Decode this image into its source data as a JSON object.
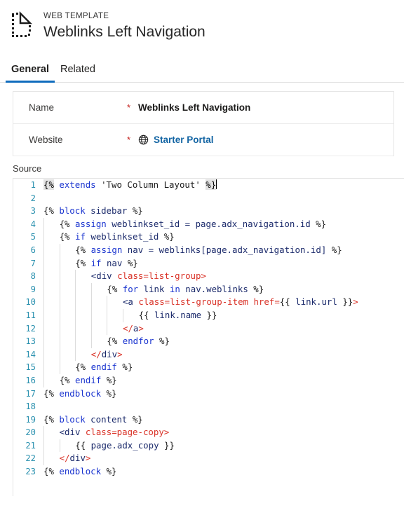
{
  "header": {
    "entity_type": "WEB TEMPLATE",
    "title": "Weblinks Left Navigation",
    "icon": "web-template-document-icon"
  },
  "tabs": [
    {
      "label": "General",
      "selected": true
    },
    {
      "label": "Related",
      "selected": false
    }
  ],
  "form": {
    "rows": [
      {
        "label": "Name",
        "required": "*",
        "value": "Weblinks Left Navigation",
        "type": "text"
      },
      {
        "label": "Website",
        "required": "*",
        "value": "Starter Portal",
        "type": "lookup",
        "icon": "globe-icon"
      }
    ]
  },
  "source": {
    "label": "Source",
    "language": "liquid-html",
    "line_count": 23,
    "lines": [
      {
        "n": 1,
        "indent": 0,
        "tokens": [
          {
            "t": "{%",
            "c": "brk"
          },
          {
            "t": " ",
            "c": "plain"
          },
          {
            "t": "extends",
            "c": "kw"
          },
          {
            "t": " 'Two Column Layout' ",
            "c": "str"
          },
          {
            "t": "%}",
            "c": "brk"
          },
          {
            "t": "",
            "c": "cursor"
          }
        ]
      },
      {
        "n": 2,
        "indent": 0,
        "tokens": []
      },
      {
        "n": 3,
        "indent": 0,
        "tokens": [
          {
            "t": "{% ",
            "c": "plain"
          },
          {
            "t": "block",
            "c": "kw"
          },
          {
            "t": " sidebar ",
            "c": "var"
          },
          {
            "t": "%}",
            "c": "plain"
          }
        ]
      },
      {
        "n": 4,
        "indent": 1,
        "tokens": [
          {
            "t": "{% ",
            "c": "plain"
          },
          {
            "t": "assign",
            "c": "kw"
          },
          {
            "t": " weblinkset_id = page.adx_navigation.id ",
            "c": "var"
          },
          {
            "t": "%}",
            "c": "plain"
          }
        ]
      },
      {
        "n": 5,
        "indent": 1,
        "tokens": [
          {
            "t": "{% ",
            "c": "plain"
          },
          {
            "t": "if",
            "c": "kw"
          },
          {
            "t": " weblinkset_id ",
            "c": "var"
          },
          {
            "t": "%}",
            "c": "plain"
          }
        ]
      },
      {
        "n": 6,
        "indent": 2,
        "tokens": [
          {
            "t": "{% ",
            "c": "plain"
          },
          {
            "t": "assign",
            "c": "kw"
          },
          {
            "t": " nav = weblinks[page.adx_navigation.id] ",
            "c": "var"
          },
          {
            "t": "%}",
            "c": "plain"
          }
        ]
      },
      {
        "n": 7,
        "indent": 2,
        "tokens": [
          {
            "t": "{% ",
            "c": "plain"
          },
          {
            "t": "if",
            "c": "kw"
          },
          {
            "t": " nav ",
            "c": "var"
          },
          {
            "t": "%}",
            "c": "plain"
          }
        ]
      },
      {
        "n": 8,
        "indent": 3,
        "tokens": [
          {
            "t": "<div",
            "c": "tag"
          },
          {
            "t": " ",
            "c": "plain"
          },
          {
            "t": "class=list-group>",
            "c": "attr"
          }
        ]
      },
      {
        "n": 9,
        "indent": 4,
        "tokens": [
          {
            "t": "{% ",
            "c": "plain"
          },
          {
            "t": "for",
            "c": "kw"
          },
          {
            "t": " link ",
            "c": "var"
          },
          {
            "t": "in",
            "c": "kw"
          },
          {
            "t": " nav.weblinks ",
            "c": "var"
          },
          {
            "t": "%}",
            "c": "plain"
          }
        ]
      },
      {
        "n": 10,
        "indent": 5,
        "tokens": [
          {
            "t": "<a",
            "c": "tag"
          },
          {
            "t": " ",
            "c": "plain"
          },
          {
            "t": "class=list-group-item href=",
            "c": "attr"
          },
          {
            "t": "{{ ",
            "c": "plain"
          },
          {
            "t": "link.url",
            "c": "var"
          },
          {
            "t": " }}",
            "c": "plain"
          },
          {
            "t": ">",
            "c": "attr"
          }
        ]
      },
      {
        "n": 11,
        "indent": 6,
        "tokens": [
          {
            "t": "{{ ",
            "c": "plain"
          },
          {
            "t": "link.name",
            "c": "var"
          },
          {
            "t": " }}",
            "c": "plain"
          }
        ]
      },
      {
        "n": 12,
        "indent": 5,
        "tokens": [
          {
            "t": "<",
            "c": "attr"
          },
          {
            "t": "/",
            "c": "attr"
          },
          {
            "t": "a",
            "c": "tag"
          },
          {
            "t": ">",
            "c": "attr"
          }
        ]
      },
      {
        "n": 13,
        "indent": 4,
        "tokens": [
          {
            "t": "{% ",
            "c": "plain"
          },
          {
            "t": "endfor",
            "c": "kw"
          },
          {
            "t": " ",
            "c": "var"
          },
          {
            "t": "%}",
            "c": "plain"
          }
        ]
      },
      {
        "n": 14,
        "indent": 3,
        "tokens": [
          {
            "t": "<",
            "c": "attr"
          },
          {
            "t": "/",
            "c": "attr"
          },
          {
            "t": "div",
            "c": "tag"
          },
          {
            "t": ">",
            "c": "attr"
          }
        ]
      },
      {
        "n": 15,
        "indent": 2,
        "tokens": [
          {
            "t": "{% ",
            "c": "plain"
          },
          {
            "t": "endif",
            "c": "kw"
          },
          {
            "t": " ",
            "c": "var"
          },
          {
            "t": "%}",
            "c": "plain"
          }
        ]
      },
      {
        "n": 16,
        "indent": 1,
        "tokens": [
          {
            "t": "{% ",
            "c": "plain"
          },
          {
            "t": "endif",
            "c": "kw"
          },
          {
            "t": " ",
            "c": "var"
          },
          {
            "t": "%}",
            "c": "plain"
          }
        ]
      },
      {
        "n": 17,
        "indent": 0,
        "tokens": [
          {
            "t": "{% ",
            "c": "plain"
          },
          {
            "t": "endblock",
            "c": "kw"
          },
          {
            "t": " ",
            "c": "var"
          },
          {
            "t": "%}",
            "c": "plain"
          }
        ]
      },
      {
        "n": 18,
        "indent": 0,
        "tokens": []
      },
      {
        "n": 19,
        "indent": 0,
        "tokens": [
          {
            "t": "{% ",
            "c": "plain"
          },
          {
            "t": "block",
            "c": "kw"
          },
          {
            "t": " content ",
            "c": "var"
          },
          {
            "t": "%}",
            "c": "plain"
          }
        ]
      },
      {
        "n": 20,
        "indent": 1,
        "tokens": [
          {
            "t": "<div",
            "c": "tag"
          },
          {
            "t": " ",
            "c": "plain"
          },
          {
            "t": "class=page-copy>",
            "c": "attr"
          }
        ]
      },
      {
        "n": 21,
        "indent": 2,
        "tokens": [
          {
            "t": "{{ ",
            "c": "plain"
          },
          {
            "t": "page.adx_copy",
            "c": "var"
          },
          {
            "t": " }}",
            "c": "plain"
          }
        ]
      },
      {
        "n": 22,
        "indent": 1,
        "tokens": [
          {
            "t": "<",
            "c": "attr"
          },
          {
            "t": "/",
            "c": "attr"
          },
          {
            "t": "div",
            "c": "tag"
          },
          {
            "t": ">",
            "c": "attr"
          }
        ]
      },
      {
        "n": 23,
        "indent": 0,
        "tokens": [
          {
            "t": "{% ",
            "c": "plain"
          },
          {
            "t": "endblock",
            "c": "kw"
          },
          {
            "t": " ",
            "c": "var"
          },
          {
            "t": "%}",
            "c": "plain"
          }
        ]
      }
    ]
  },
  "colors": {
    "accent": "#0f6cbd",
    "link": "#1264a3",
    "required": "#c5221f",
    "line_number": "#2b91af",
    "keyword": "#1a34cf",
    "attribute": "#d93025",
    "tag": "#1b2a6b"
  }
}
